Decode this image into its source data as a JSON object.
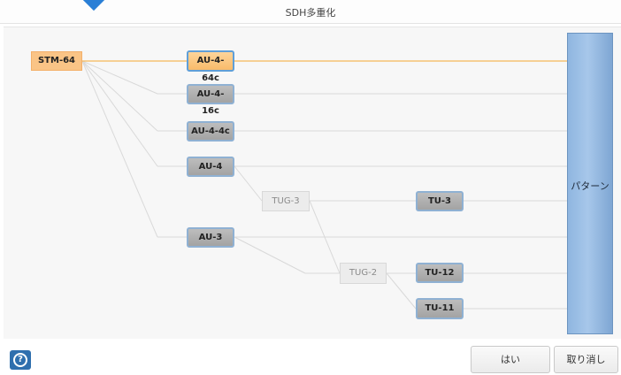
{
  "window": {
    "title": "SDH多重化"
  },
  "nodes": {
    "stm64": "STM-64",
    "au4_64c": "AU-4-64c",
    "au4_16c": "AU-4-16c",
    "au4_4c": "AU-4-4c",
    "au4": "AU-4",
    "tug3": "TUG-3",
    "tu3": "TU-3",
    "au3": "AU-3",
    "tug2": "TUG-2",
    "tu12": "TU-12",
    "tu11": "TU-11"
  },
  "pattern": {
    "label": "パターン"
  },
  "footer": {
    "yes_label": "はい",
    "cancel_label": "取り消し",
    "help_icon": "?"
  },
  "colors": {
    "selected_path": "#f5b85a",
    "connector": "#d9d9d9",
    "pattern_fill": "#8fb6e0",
    "help_button": "#2f6fae"
  },
  "icons": [
    "help-icon"
  ]
}
